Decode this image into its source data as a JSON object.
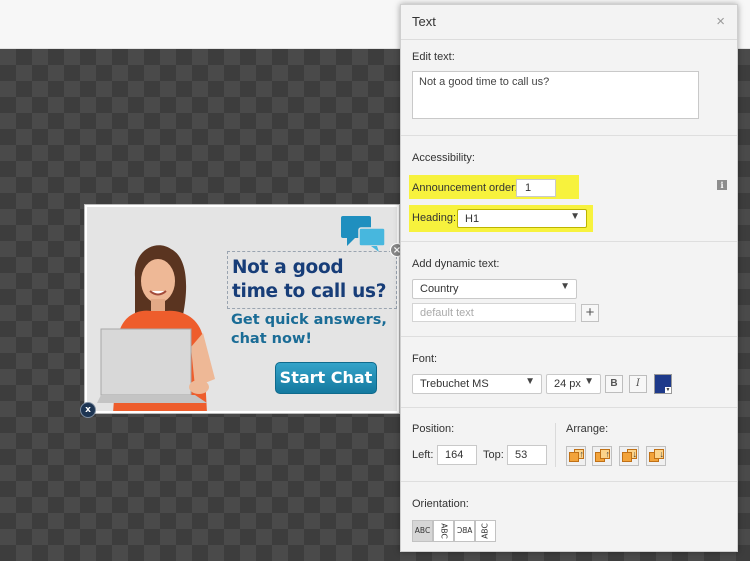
{
  "banner": {
    "headline": "Not a good time to call us?",
    "subline": "Get quick answers, chat now!",
    "button_label": "Start Chat",
    "close_glyph": "×",
    "delete_glyph": "x"
  },
  "panel": {
    "title": "Text",
    "close_glyph": "×",
    "edit_text": {
      "label": "Edit text:",
      "value": "Not a good time to call us?"
    },
    "accessibility": {
      "label": "Accessibility:",
      "announcement_label": "Announcement order:",
      "announcement_value": "1",
      "heading_label": "Heading:",
      "heading_value": "H1",
      "info_glyph": "i",
      "highlight_color": "#f7f23d"
    },
    "dynamic_text": {
      "label": "Add dynamic text:",
      "selected": "Country",
      "placeholder": "default text",
      "add_glyph": "+"
    },
    "font": {
      "label": "Font:",
      "family": "Trebuchet MS",
      "size": "24 px",
      "bold_label": "B",
      "italic_label": "I",
      "color": "#1e3a8a"
    },
    "position": {
      "label": "Position:",
      "left_label": "Left:",
      "left_value": "164",
      "top_label": "Top:",
      "top_value": "53"
    },
    "arrange": {
      "label": "Arrange:",
      "buttons": [
        "bring-to-front",
        "bring-forward",
        "send-backward",
        "send-to-back"
      ]
    },
    "orientation": {
      "label": "Orientation:",
      "options": [
        "ABC",
        "ABC",
        "ABC",
        "ABC"
      ]
    }
  },
  "colors": {
    "canvas_dark": "#4a4a4a",
    "canvas_light": "#3d3d3d",
    "headline_color": "#173d78",
    "subline_color": "#1a6c96",
    "button_color": "#14799f"
  }
}
